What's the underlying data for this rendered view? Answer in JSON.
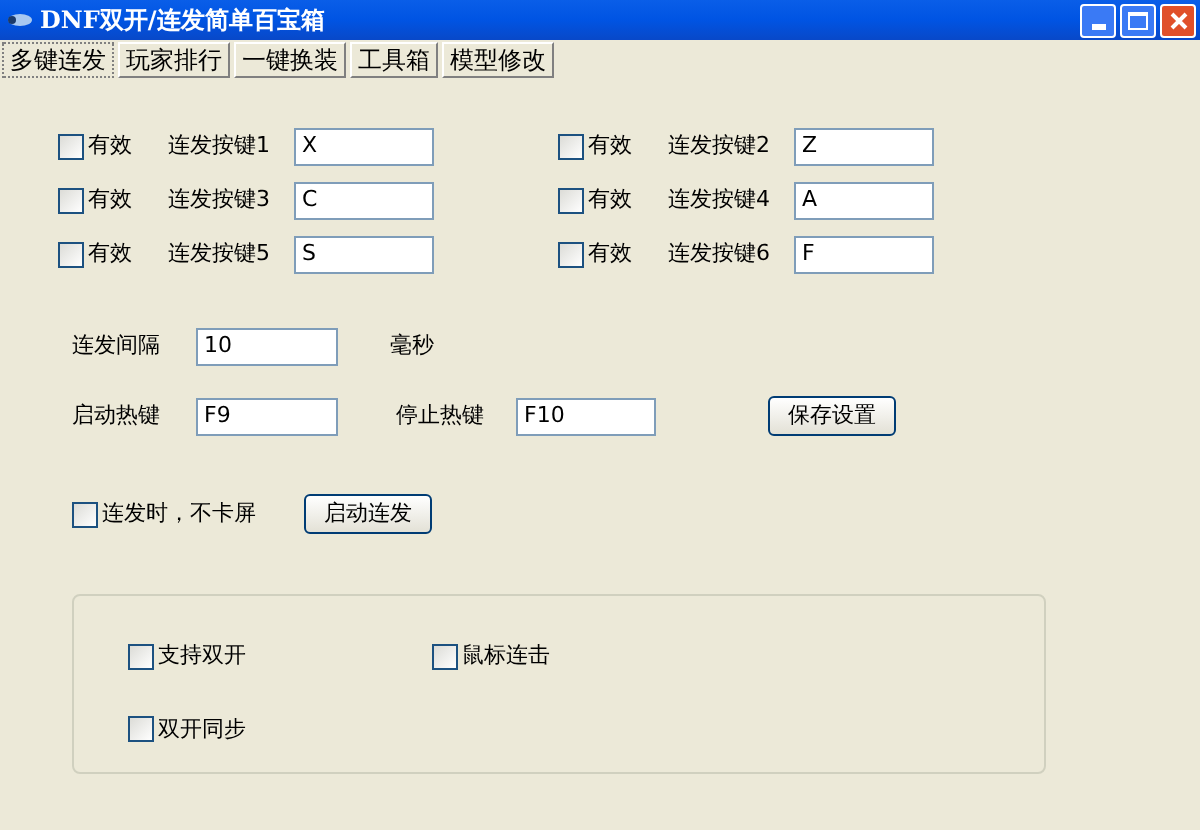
{
  "window": {
    "title": "DNF双开/连发简单百宝箱"
  },
  "tabs": [
    {
      "label": "多键连发",
      "selected": true
    },
    {
      "label": "玩家排行",
      "selected": false
    },
    {
      "label": "一键换装",
      "selected": false
    },
    {
      "label": "工具箱",
      "selected": false
    },
    {
      "label": "模型修改",
      "selected": false
    }
  ],
  "keys": [
    {
      "enabled_label": "有效",
      "checked": false,
      "label": "连发按键1",
      "value": "X"
    },
    {
      "enabled_label": "有效",
      "checked": false,
      "label": "连发按键2",
      "value": "Z"
    },
    {
      "enabled_label": "有效",
      "checked": false,
      "label": "连发按键3",
      "value": "C"
    },
    {
      "enabled_label": "有效",
      "checked": false,
      "label": "连发按键4",
      "value": "A"
    },
    {
      "enabled_label": "有效",
      "checked": false,
      "label": "连发按键5",
      "value": "S"
    },
    {
      "enabled_label": "有效",
      "checked": false,
      "label": "连发按键6",
      "value": "F"
    }
  ],
  "interval": {
    "label": "连发间隔",
    "value": "10",
    "unit": "毫秒"
  },
  "start_hotkey": {
    "label": "启动热键",
    "value": "F9"
  },
  "stop_hotkey": {
    "label": "停止热键",
    "value": "F10"
  },
  "save_button": "保存设置",
  "no_freeze": {
    "label": "连发时，不卡屏",
    "checked": false
  },
  "start_button": "启动连发",
  "options": [
    {
      "label": "支持双开",
      "checked": false
    },
    {
      "label": "鼠标连击",
      "checked": false
    },
    {
      "label": "双开同步",
      "checked": false
    }
  ]
}
